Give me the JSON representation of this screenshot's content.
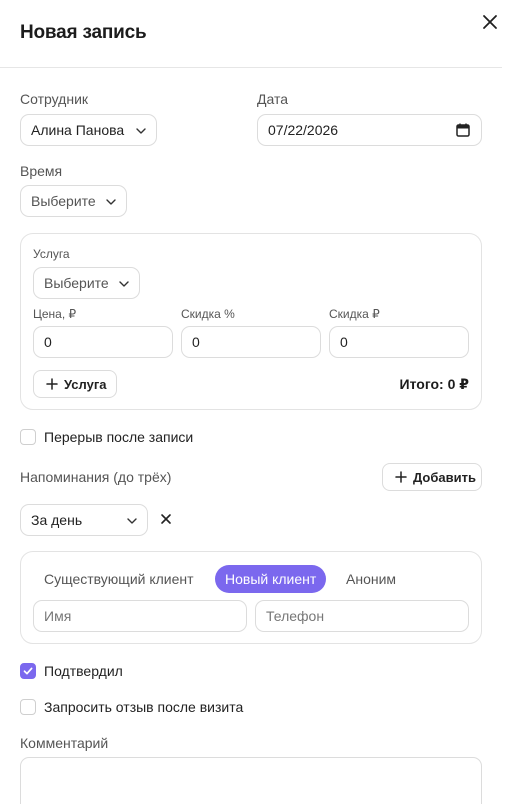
{
  "dialog": {
    "title": "Новая запись"
  },
  "employee": {
    "label": "Сотрудник",
    "value": "Алина Панова"
  },
  "date": {
    "label": "Дата",
    "value": "07/22/2026"
  },
  "time": {
    "label": "Время",
    "value": "Выберите"
  },
  "service": {
    "label": "Услуга",
    "value": "Выберите",
    "price_label": "Цена, ₽",
    "price_value": "0",
    "discount_pct_label": "Скидка %",
    "discount_pct_value": "0",
    "discount_rub_label": "Скидка ₽",
    "discount_rub_value": "0",
    "add_service_label": "Услуга",
    "total": "Итого: 0 ₽"
  },
  "break_after": {
    "label": "Перерыв после записи",
    "checked": false
  },
  "reminders": {
    "label": "Напоминания (до трёх)",
    "add_label": "Добавить",
    "items": [
      {
        "value": "За день"
      }
    ]
  },
  "client": {
    "tabs": [
      {
        "label": "Существующий клиент",
        "active": false
      },
      {
        "label": "Новый клиент",
        "active": true
      },
      {
        "label": "Аноним",
        "active": false
      }
    ],
    "name_placeholder": "Имя",
    "phone_placeholder": "Телефон"
  },
  "confirmed": {
    "label": "Подтвердил",
    "checked": true
  },
  "request_review": {
    "label": "Запросить отзыв после визита",
    "checked": false
  },
  "comment": {
    "label": "Комментарий",
    "value": ""
  },
  "colors": {
    "accent": "#7b68ee",
    "border": "#dcdcdc",
    "text": "#1f1f1f"
  }
}
